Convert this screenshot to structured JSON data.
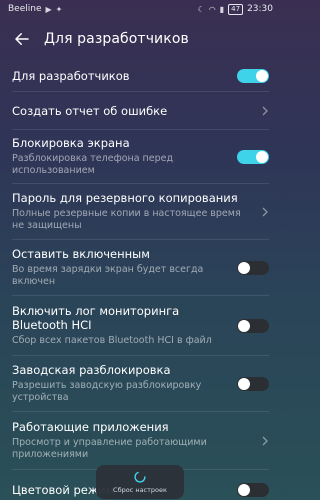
{
  "status_bar": {
    "carrier": "Beeline",
    "battery": "47",
    "time": "23:30"
  },
  "header": {
    "title": "Для разработчиков"
  },
  "settings": [
    {
      "title": "Для разработчиков",
      "subtitle": "",
      "control": "toggle",
      "on": true
    },
    {
      "title": "Создать отчет об ошибке",
      "subtitle": "",
      "control": "chevron"
    },
    {
      "title": "Блокировка экрана",
      "subtitle": "Разблокировка телефона перед использованием",
      "control": "toggle",
      "on": true
    },
    {
      "title": "Пароль для резервного копирования",
      "subtitle": "Полные резервные копии в настоящее время не защищены",
      "control": "chevron"
    },
    {
      "title": "Оставить включенным",
      "subtitle": "Во время зарядки экран будет всегда включен",
      "control": "toggle",
      "on": false
    },
    {
      "title": "Включить лог мониторинга Bluetooth HCI",
      "subtitle": "Сбор всех пакетов Bluetooth HCI в файл",
      "control": "toggle",
      "on": false
    },
    {
      "title": "Заводская разблокировка",
      "subtitle": "Разрешить заводскую разблокировку устройства",
      "control": "toggle",
      "on": false
    },
    {
      "title": "Работающие приложения",
      "subtitle": "Просмотр и управление работающими приложениями",
      "control": "chevron"
    },
    {
      "title": "Цветовой режим",
      "subtitle": "",
      "control": "toggle",
      "on": false
    }
  ],
  "toast": {
    "label": "Сброс настроек"
  },
  "colors": {
    "accent": "#3ed3e9",
    "toggle_off": "#2b2f33"
  }
}
